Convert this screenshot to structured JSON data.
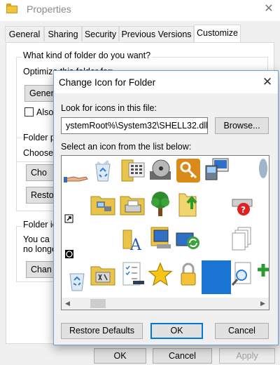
{
  "properties": {
    "title": "Properties",
    "tabs": [
      "General",
      "Sharing",
      "Security",
      "Previous Versions",
      "Customize"
    ],
    "active_tab": "Customize",
    "folder_type_label": "What kind of folder do you want?",
    "optimize_label": "Optimize this folder for:",
    "optimize_value": "General items",
    "also_apply_label": "Also",
    "folder_pictures_label": "Folder p",
    "choose_label": "Choose",
    "choose_file_button": "Cho",
    "restore_default_button": "Resto",
    "folder_icons_label": "Folder ic",
    "folder_icons_text_1": "You ca",
    "folder_icons_text_2": "no longe",
    "change_icon_button": "Chan",
    "buttons": {
      "ok": "OK",
      "cancel": "Cancel",
      "apply": "Apply"
    }
  },
  "dialog": {
    "title": "Change Icon for  Folder",
    "look_label": "Look for icons in this file:",
    "path_value": "ystemRoot%\\System32\\SHELL32.dll",
    "browse_button": "Browse...",
    "select_label": "Select an icon from the list below:",
    "icons": [
      "hand-sharing-icon",
      "shortcut-arrow-icon",
      "shortcut-overlay-icon",
      "recycle-bin-empty-icon",
      "folder-network-icon",
      "blank-area",
      "recycle-bin-full-icon",
      "keyboard-grid-icon",
      "folder-printer-icon",
      "folder-typography-icon",
      "folder-settings-icon",
      "dvd-drive-icon",
      "tree-icon",
      "monitor-window-icon",
      "checklist-icon",
      "key-icon",
      "folder-upload-icon",
      "sync-monitor-icon",
      "star-icon",
      "computer-network-icon",
      "padlock-icon",
      "blue-tile-icon",
      "disconnected-drive-icon",
      "documents-stack-icon",
      "magnifier-page-icon",
      "drive-icon",
      "green-plus-icon"
    ],
    "buttons": {
      "restore": "Restore Defaults",
      "ok": "OK",
      "cancel": "Cancel"
    }
  }
}
